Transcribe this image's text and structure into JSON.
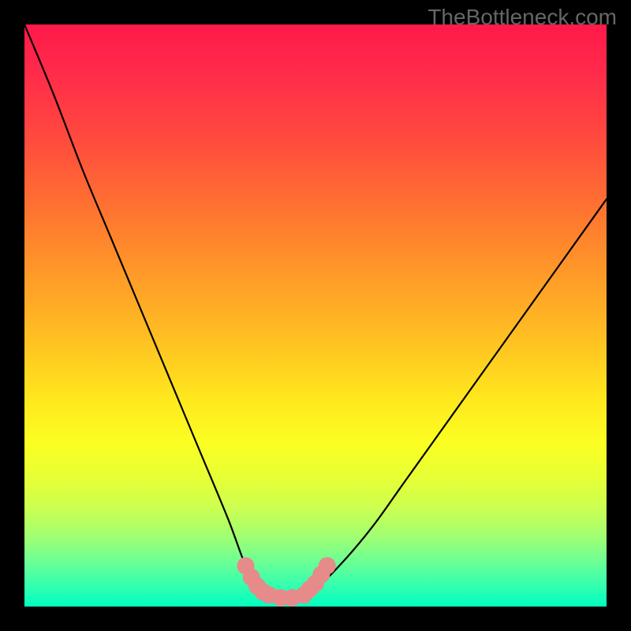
{
  "watermark": "TheBottleneck.com",
  "chart_data": {
    "type": "line",
    "title": "",
    "xlabel": "",
    "ylabel": "",
    "xlim": [
      0,
      100
    ],
    "ylim": [
      0,
      100
    ],
    "grid": false,
    "background_gradient": {
      "top": "#ff1a4a",
      "mid": "#ffe61e",
      "bottom": "#00ffc0"
    },
    "series": [
      {
        "name": "bottleneck-curve",
        "x": [
          0,
          5,
          10,
          15,
          20,
          25,
          30,
          35,
          38,
          40,
          42,
          45,
          48,
          50,
          55,
          60,
          65,
          70,
          75,
          80,
          85,
          90,
          95,
          100
        ],
        "values": [
          100,
          88,
          75,
          63,
          51,
          39,
          27,
          15,
          7,
          4,
          2,
          1,
          2,
          3,
          8,
          14,
          21,
          28,
          35,
          42,
          49,
          56,
          63,
          70
        ]
      }
    ],
    "markers": {
      "name": "optimal-zone",
      "color": "#e78a8a",
      "points": [
        {
          "x": 38,
          "y": 7
        },
        {
          "x": 39,
          "y": 5
        },
        {
          "x": 40,
          "y": 3.5
        },
        {
          "x": 41,
          "y": 2.5
        },
        {
          "x": 42,
          "y": 2
        },
        {
          "x": 44,
          "y": 1.5
        },
        {
          "x": 46,
          "y": 1.5
        },
        {
          "x": 48,
          "y": 2
        },
        {
          "x": 49,
          "y": 3
        },
        {
          "x": 50,
          "y": 4
        },
        {
          "x": 51,
          "y": 5.5
        },
        {
          "x": 52,
          "y": 7
        }
      ]
    }
  }
}
